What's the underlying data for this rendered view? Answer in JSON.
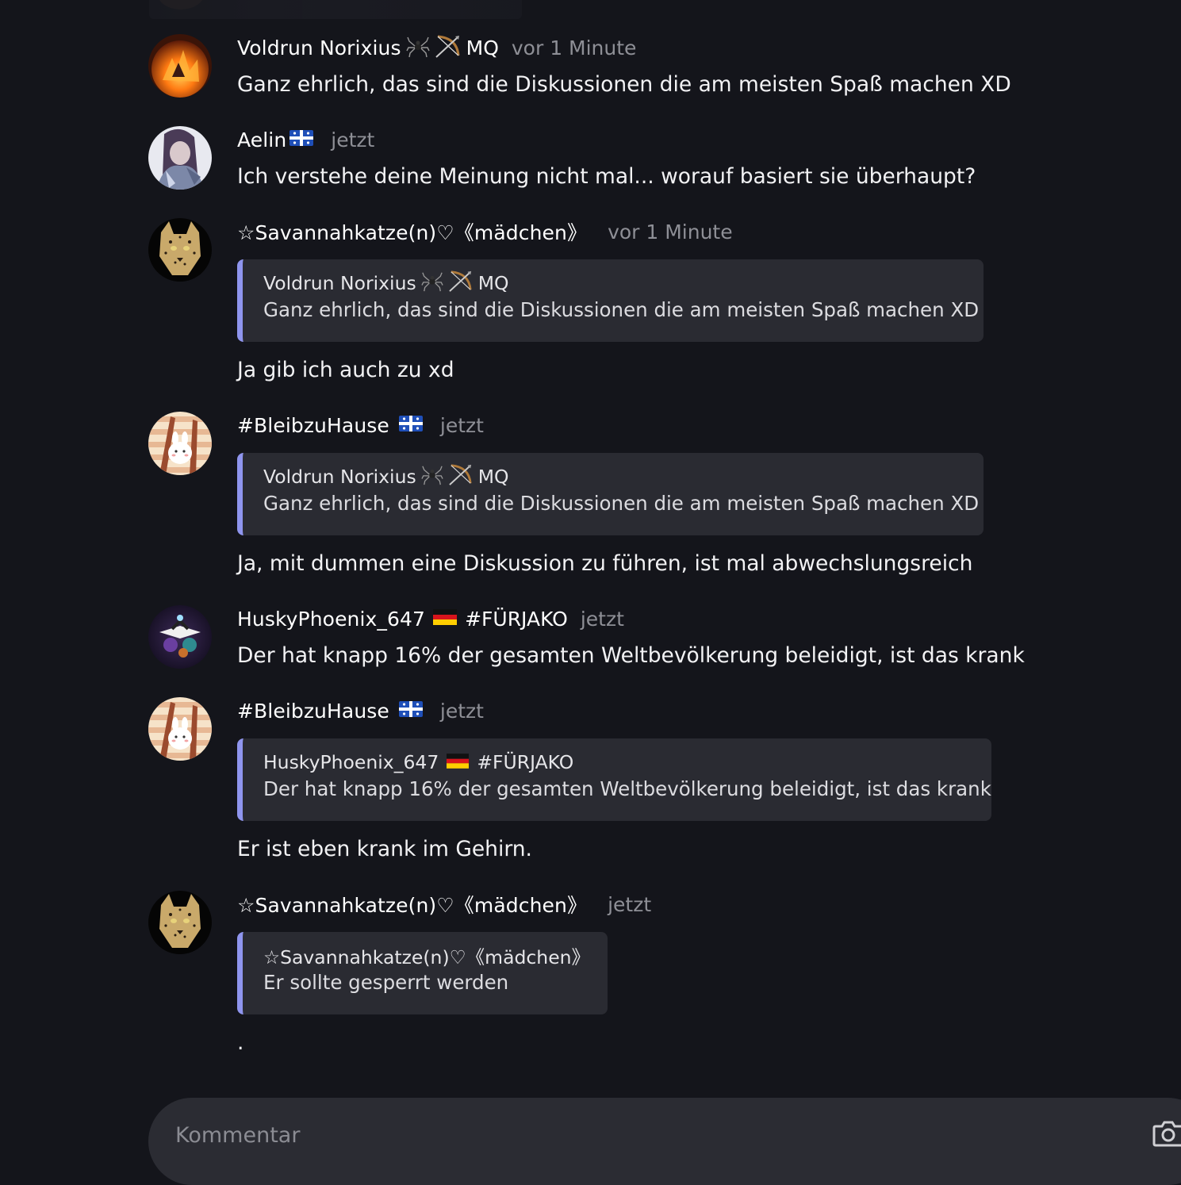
{
  "comments": [
    {
      "user": "Voldrun Norixius",
      "badge": "MQ",
      "time": "vor 1 Minute",
      "text": "Ganz ehrlich, das sind die Diskussionen die am meisten Spaß machen XD"
    },
    {
      "user": "Aelin",
      "time": "jetzt",
      "text": "Ich verstehe deine Meinung nicht mal... worauf basiert sie überhaupt?"
    },
    {
      "user": "☆Savannahkatze(n)♡《mädchen》",
      "time": "vor 1 Minute",
      "quote_user": "Voldrun Norixius",
      "quote_badge": "MQ",
      "quote_text": "Ganz ehrlich, das sind die Diskussionen die am meisten Spaß machen XD",
      "text": "Ja gib ich auch zu xd"
    },
    {
      "user": "#BleibzuHause",
      "time": "jetzt",
      "quote_user": "Voldrun Norixius",
      "quote_badge": "MQ",
      "quote_text": "Ganz ehrlich, das sind die Diskussionen die am meisten Spaß machen XD",
      "text": "Ja, mit dummen eine Diskussion zu führen, ist mal abwechslungsreich"
    },
    {
      "user": "HuskyPhoenix_647",
      "badge": "#FÜRJAKO",
      "time": "jetzt",
      "text": "Der hat knapp 16% der gesamten Weltbevölkerung beleidigt, ist das krank"
    },
    {
      "user": "#BleibzuHause",
      "time": "jetzt",
      "quote_user": "HuskyPhoenix_647",
      "quote_badge": "#FÜRJAKO",
      "quote_text": "Der hat knapp 16% der gesamten Weltbevölkerung beleidigt, ist das krank",
      "text": "Er ist eben krank im Gehirn."
    },
    {
      "user": "☆Savannahkatze(n)♡《mädchen》",
      "time": "jetzt",
      "quote_user": "☆Savannahkatze(n)♡《mädchen》",
      "quote_text": "Er sollte gesperrt werden",
      "text": "."
    }
  ],
  "composer": {
    "placeholder": "Kommentar"
  },
  "icons": {
    "spider": "spider-icon",
    "bow": "bow-and-arrow-icon",
    "flag_quebec": "quebec-flag-icon",
    "flag_germany": "germany-flag-icon",
    "camera": "camera-icon"
  },
  "colors": {
    "background": "#14151b",
    "quote_bar": "#8f95ee",
    "quote_bg": "#2a2b32",
    "timestamp": "#8e8f96"
  }
}
